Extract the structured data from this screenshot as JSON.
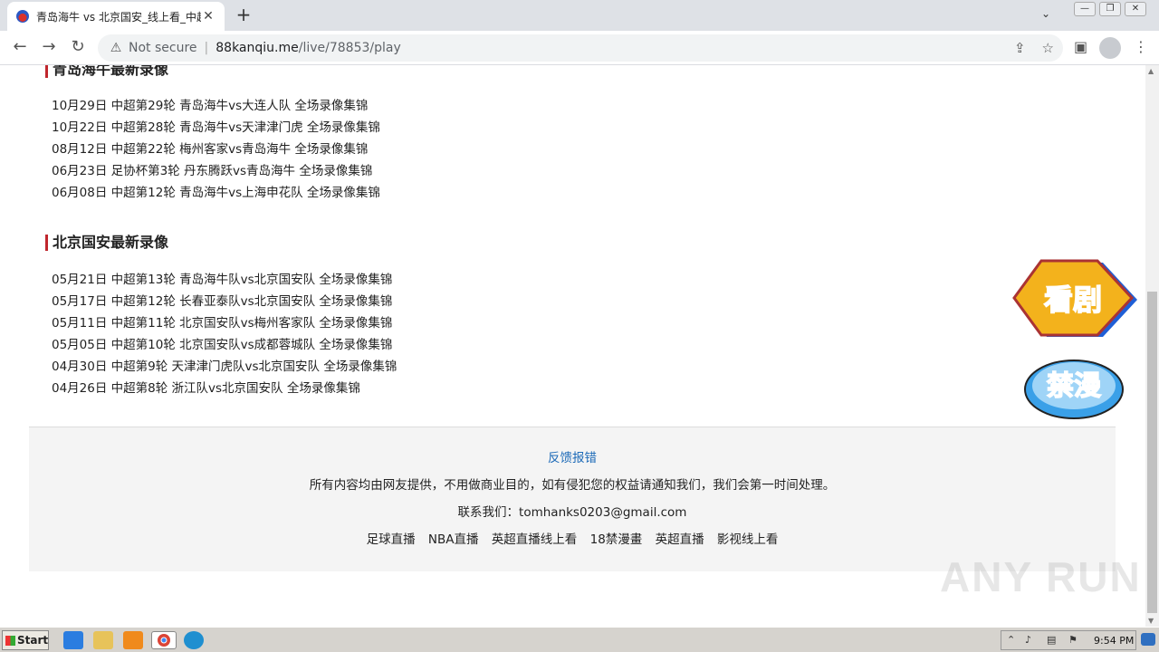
{
  "browser": {
    "tab_title": "青岛海牛 vs 北京国安_线上看_中超",
    "tab_close": "✕",
    "new_tab": "+",
    "security_label": "Not secure",
    "url_host": "88kanqiu.me",
    "url_path": "/live/78853/play",
    "window_controls": [
      "—",
      "❐",
      "✕"
    ]
  },
  "page": {
    "section1": {
      "title": "青岛海牛最新录像",
      "items": [
        "10月29日 中超第29轮 青岛海牛vs大连人队 全场录像集锦",
        "10月22日 中超第28轮 青岛海牛vs天津津门虎 全场录像集锦",
        "08月12日 中超第22轮 梅州客家vs青岛海牛 全场录像集锦",
        "06月23日 足协杯第3轮 丹东腾跃vs青岛海牛 全场录像集锦",
        "06月08日 中超第12轮 青岛海牛vs上海申花队 全场录像集锦"
      ]
    },
    "section2": {
      "title": "北京国安最新录像",
      "items": [
        "05月21日 中超第13轮 青岛海牛队vs北京国安队 全场录像集锦",
        "05月17日 中超第12轮 长春亚泰队vs北京国安队 全场录像集锦",
        "05月11日 中超第11轮 北京国安队vs梅州客家队 全场录像集锦",
        "05月05日 中超第10轮 北京国安队vs成都蓉城队 全场录像集锦",
        "04月30日 中超第9轮 天津津门虎队vs北京国安队 全场录像集锦",
        "04月26日 中超第8轮 浙江队vs北京国安队 全场录像集锦"
      ]
    },
    "footer": {
      "feedback": "反馈报错",
      "disclaimer": "所有内容均由网友提供，不用做商业目的，如有侵犯您的权益请通知我们，我们会第一时间处理。",
      "contact": "联系我们：tomhanks0203@gmail.com",
      "links": [
        "足球直播",
        "NBA直播",
        "英超直播线上看",
        "18禁漫畫",
        "英超直播",
        "影视线上看"
      ]
    },
    "ads": {
      "ad1_text": "看剧",
      "ad2_text": "禁漫"
    },
    "watermark": "ANY RUN"
  },
  "taskbar": {
    "start_label": "Start",
    "clock": "9:54 PM"
  },
  "colors": {
    "accent_red": "#c0262d",
    "link_blue": "#1e6bb8",
    "footer_bg": "#f4f4f4"
  }
}
